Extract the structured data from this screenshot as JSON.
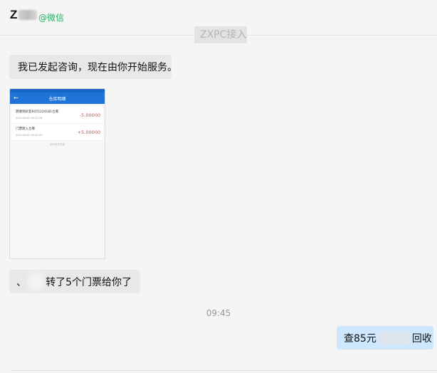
{
  "header": {
    "contact_initial": "Z",
    "wechat_tag": "@微信"
  },
  "system_notice": "ZXPC接入",
  "messages": {
    "msg1": "我已发起咨询，现在由你开始服务。",
    "screenshot": {
      "title": "仓库明细",
      "rows": [
        {
          "text": "转赠到好友6055224181仓库",
          "date": "2022-06-01 09:12:26",
          "amount": "-5.00000"
        },
        {
          "text": "门票转入仓库",
          "date": "2022-06-01 09:12:03",
          "amount": "+5.00000"
        }
      ],
      "footer": "没有更多数据"
    },
    "msg2_prefix": "、",
    "msg2_suffix": "转了5个门票给你了",
    "time": "09:45",
    "msg3_prefix": "查85元",
    "msg3_suffix": "回收"
  },
  "colors": {
    "wechat_green": "#2aae67",
    "incoming_bubble": "#e8e8e8",
    "outgoing_bubble": "#cde7ff",
    "app_blue": "#1f73d6",
    "amount_red": "#e04b4b"
  }
}
